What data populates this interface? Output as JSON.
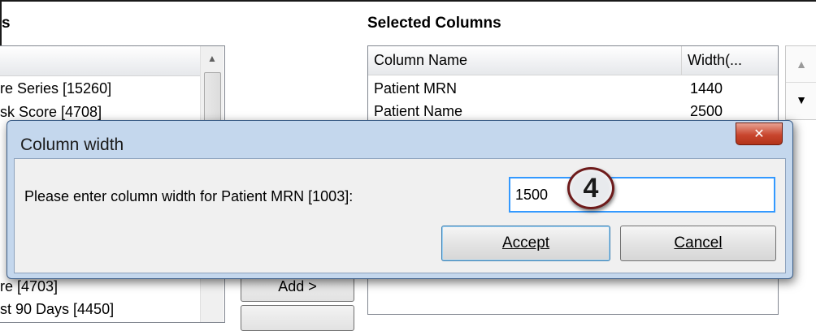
{
  "available": {
    "header": "s",
    "rows": [
      "re Series [15260]",
      "sk Score [4708]",
      "re [4703]",
      "st 90 Days [4450]"
    ]
  },
  "add_button": {
    "label": "Add >"
  },
  "selected": {
    "header": "Selected Columns",
    "columns": [
      "Column Name",
      "Width(..."
    ],
    "rows": [
      {
        "name": "Patient MRN",
        "width": "1440"
      },
      {
        "name": "Patient Name",
        "width": "2500"
      }
    ]
  },
  "dialog": {
    "title": "Column width",
    "close_label": "✕",
    "prompt": "Please enter column width for Patient MRN [1003]:",
    "input_value": "1500",
    "step_badge": "4",
    "accept_label": "Accept",
    "cancel_label": "Cancel"
  },
  "colors": {
    "dialog_frame": "#c4d7ed",
    "close_button": "#c9462e",
    "input_focus_border": "#3399ff"
  }
}
